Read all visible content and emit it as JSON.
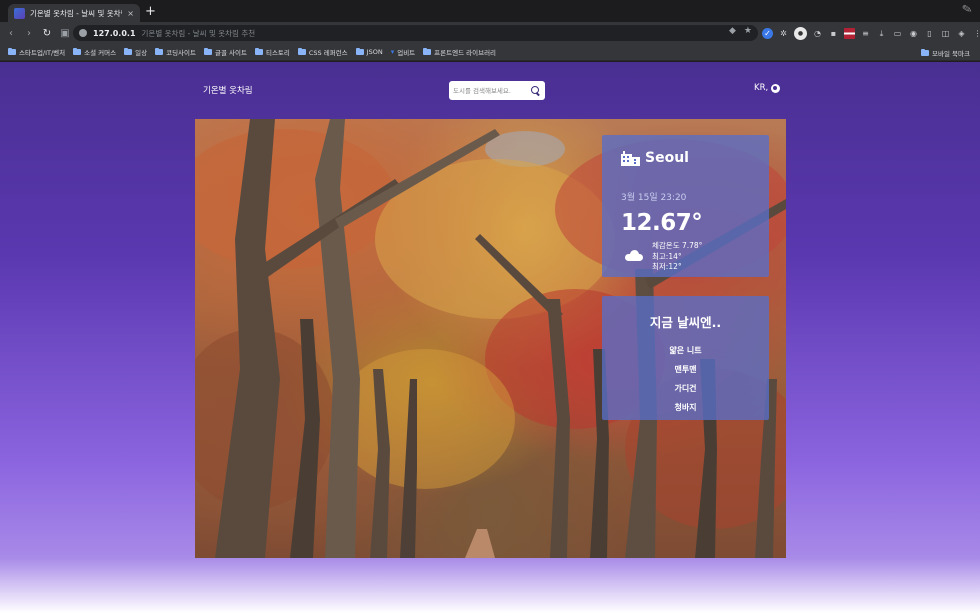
{
  "browser": {
    "tab_title": "기온별 옷차림 - 날씨 및 옷차림 추천",
    "tab_close": "×",
    "new_tab": "+",
    "address_host": "127.0.0.1",
    "address_title": "기온별 옷차림 - 날씨 및 옷차림 추천",
    "bookmarks": [
      "스타트업/IT/벤처",
      "소셜 커머스",
      "일상",
      "코딩사이트",
      "글꼴 사이트",
      "티스토리",
      "CSS 레퍼런스",
      "JSON",
      "업비트",
      "프론트엔드 라이브러리"
    ],
    "bookmark_right": "모바일 북마크"
  },
  "header": {
    "site_title": "기온별 옷차림",
    "search_placeholder": "도시를 검색해보세요.",
    "locale": "KR,"
  },
  "weather": {
    "city": "Seoul",
    "datetime": "3월 15일 23:20",
    "temperature": "12.67°",
    "feels_like": "체감온도 7.78°",
    "high": "최고:14°",
    "low": "최저:12°",
    "icon": "cloud-icon"
  },
  "outfit": {
    "heading": "지금 날씨엔..",
    "items": [
      "얇은 니트",
      "맨투맨",
      "가디건",
      "청바지"
    ]
  }
}
